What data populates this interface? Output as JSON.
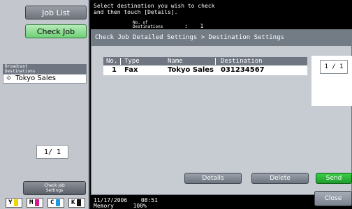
{
  "nav": {
    "job_list_label": "Job List",
    "check_job_label": "Check Job"
  },
  "message": {
    "line1": "Select destination you wish to check",
    "line2": "and then touch [Details].",
    "count_label_1": "No. of",
    "count_label_2": "Destinations",
    "count_colon": ":",
    "count_value": "1"
  },
  "broadcast": {
    "header_1": "Broadcast",
    "header_2": "Destinations",
    "items": [
      {
        "label": "Tokyo Sales",
        "icon": "fax-icon"
      }
    ],
    "page_indicator": "1/ 1"
  },
  "dialog": {
    "title": "Check Job Detailed Settings > Destination Settings",
    "table": {
      "headers": [
        "No.",
        "Type",
        "Name",
        "Destination"
      ],
      "rows": [
        [
          "1",
          "Fax",
          "Tokyo Sales",
          "031234567"
        ]
      ]
    },
    "page_indicator": "1 / 1",
    "buttons": {
      "details": "Details",
      "delete": "Delete"
    }
  },
  "actions": {
    "send": "Send",
    "close": "Close"
  },
  "bottom_left": {
    "check_job_settings_1": "Check Job",
    "check_job_settings_2": "Settings",
    "toners": [
      {
        "label": "Y",
        "color": "#f2d400"
      },
      {
        "label": "M",
        "color": "#d81b8b"
      },
      {
        "label": "C",
        "color": "#1e9be0"
      },
      {
        "label": "K",
        "color": "#111111"
      }
    ]
  },
  "status": {
    "date": "11/17/2006",
    "time": "08:51",
    "memory_label": "Memory",
    "memory_value": "100%"
  }
}
